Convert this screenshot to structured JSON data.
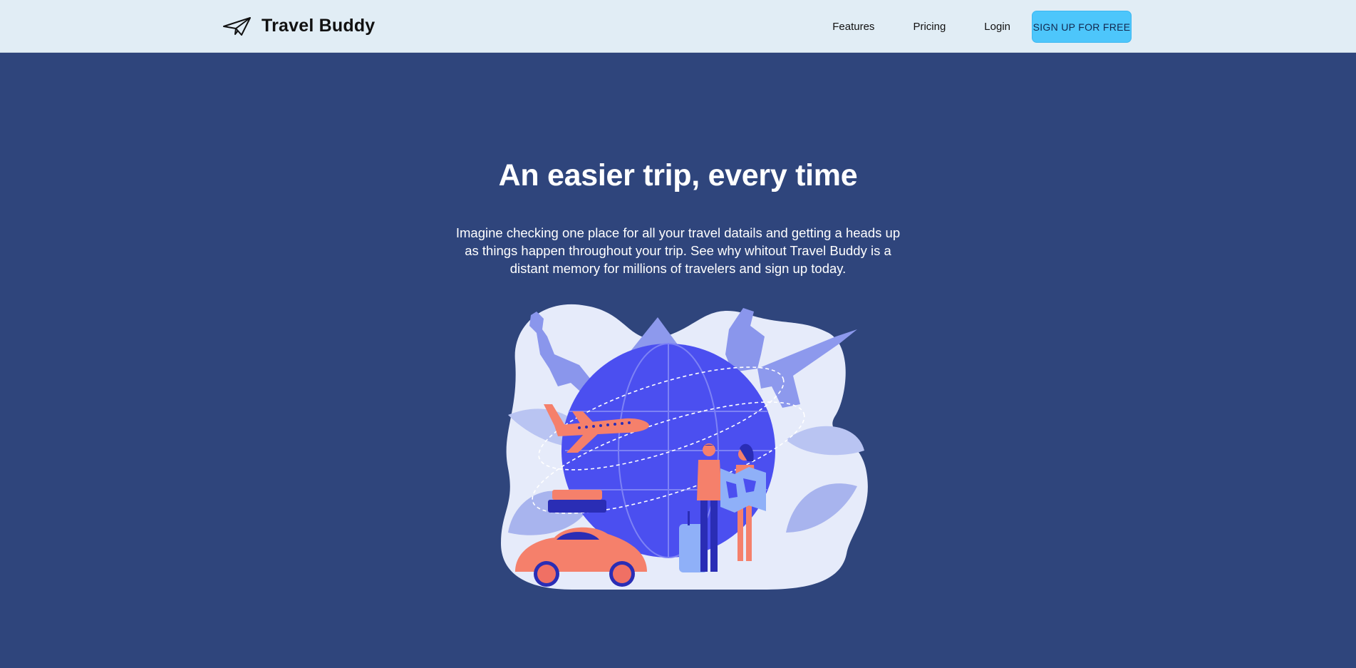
{
  "brand": {
    "name": "Travel Buddy",
    "icon": "paper-plane-icon"
  },
  "nav": {
    "links": [
      "Features",
      "Pricing",
      "Login"
    ],
    "cta_label": "SIGN UP FOR FREE"
  },
  "hero": {
    "title": "An easier trip, every time",
    "text": "Imagine checking one place for all your travel datails and getting a heads up as things happen throughout your trip. See why whitout Travel Buddy is a distant memory for millions of travelers and sign up today.",
    "illustration": "travel-illustration"
  },
  "colors": {
    "nav_background": "#e1edf5",
    "hero_background": "#2f457c",
    "cta_background": "#4dc6fb",
    "accent_coral": "#f5806b",
    "globe_blue": "#4b4ff0"
  }
}
